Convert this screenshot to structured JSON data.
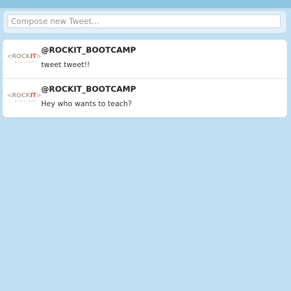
{
  "compose": {
    "placeholder": "Compose new Tweet..."
  },
  "feed": {
    "tweets": [
      {
        "avatar": {
          "logo_main": "<ROCKIT>",
          "logo_sub": "BOOTCAMP"
        },
        "handle": "@ROCKIT_BOOTCAMP",
        "text": "tweet tweet!!"
      },
      {
        "avatar": {
          "logo_main": "<ROCKIT>",
          "logo_sub": "BOOTCAMP"
        },
        "handle": "@ROCKIT_BOOTCAMP",
        "text": "Hey who wants to teach?"
      }
    ]
  },
  "colors": {
    "background": "#c1dff0",
    "top_band": "#8fc4e2",
    "logo_accent": "#e25a36"
  }
}
